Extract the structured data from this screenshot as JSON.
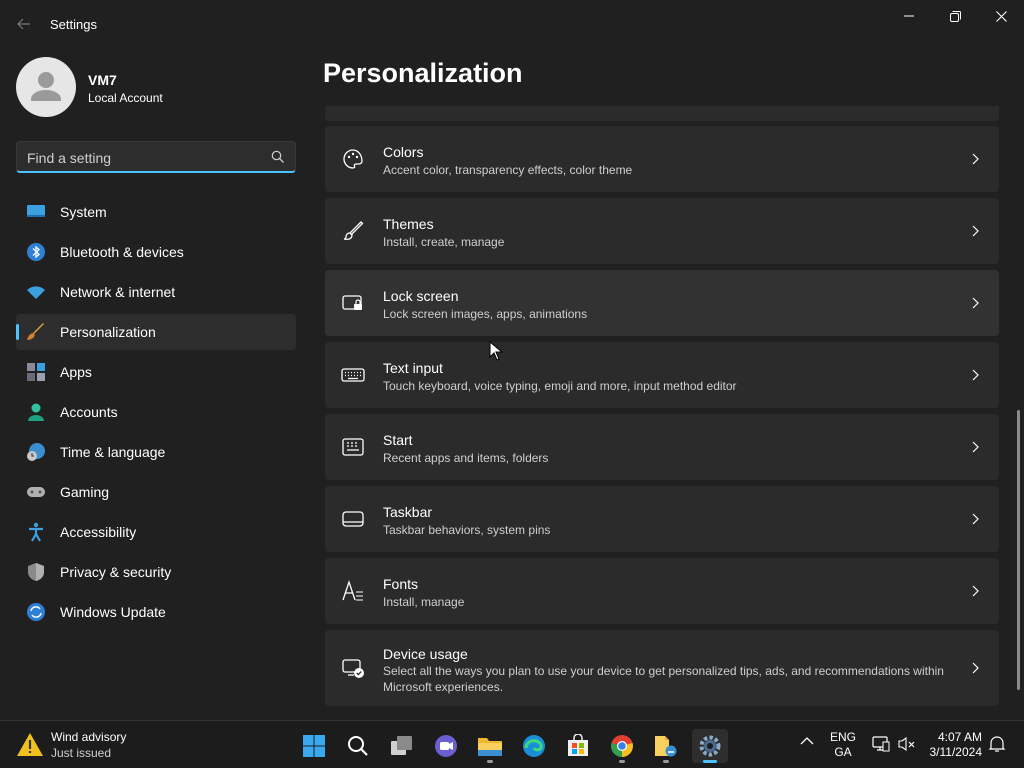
{
  "window": {
    "app_title": "Settings",
    "back_icon": "back-arrow-icon",
    "controls": [
      "minimize-icon",
      "maximize-icon",
      "close-icon"
    ]
  },
  "profile": {
    "name": "VM7",
    "account_type": "Local Account"
  },
  "search": {
    "placeholder": "Find a setting"
  },
  "sidebar": {
    "items": [
      {
        "label": "System",
        "icon": "monitor-icon",
        "selected": false
      },
      {
        "label": "Bluetooth & devices",
        "icon": "bluetooth-icon",
        "selected": false
      },
      {
        "label": "Network & internet",
        "icon": "wifi-icon",
        "selected": false
      },
      {
        "label": "Personalization",
        "icon": "paintbrush-icon",
        "selected": true
      },
      {
        "label": "Apps",
        "icon": "apps-icon",
        "selected": false
      },
      {
        "label": "Accounts",
        "icon": "person-icon",
        "selected": false
      },
      {
        "label": "Time & language",
        "icon": "clock-globe-icon",
        "selected": false
      },
      {
        "label": "Gaming",
        "icon": "gamepad-icon",
        "selected": false
      },
      {
        "label": "Accessibility",
        "icon": "accessibility-icon",
        "selected": false
      },
      {
        "label": "Privacy & security",
        "icon": "shield-icon",
        "selected": false
      },
      {
        "label": "Windows Update",
        "icon": "update-icon",
        "selected": false
      }
    ]
  },
  "main": {
    "title": "Personalization",
    "cards": [
      {
        "title": "Colors",
        "subtitle": "Accent color, transparency effects, color theme",
        "icon": "palette-icon"
      },
      {
        "title": "Themes",
        "subtitle": "Install, create, manage",
        "icon": "brush-icon"
      },
      {
        "title": "Lock screen",
        "subtitle": "Lock screen images, apps, animations",
        "icon": "lock-screen-icon"
      },
      {
        "title": "Text input",
        "subtitle": "Touch keyboard, voice typing, emoji and more, input method editor",
        "icon": "keyboard-icon"
      },
      {
        "title": "Start",
        "subtitle": "Recent apps and items, folders",
        "icon": "start-icon"
      },
      {
        "title": "Taskbar",
        "subtitle": "Taskbar behaviors, system pins",
        "icon": "taskbar-icon"
      },
      {
        "title": "Fonts",
        "subtitle": "Install, manage",
        "icon": "fonts-icon"
      },
      {
        "title": "Device usage",
        "subtitle": "Select all the ways you plan to use your device to get personalized tips, ads, and recommendations within Microsoft experiences.",
        "icon": "device-usage-icon"
      }
    ]
  },
  "taskbar": {
    "weather": {
      "title": "Wind advisory",
      "subtitle": "Just issued",
      "icon": "warning-weather-icon"
    },
    "apps": [
      "windows-start-icon",
      "search-icon",
      "task-view-icon",
      "teams-chat-icon",
      "file-explorer-icon",
      "edge-icon",
      "store-icon",
      "chrome-icon",
      "file-manager-icon",
      "settings-icon"
    ],
    "language": {
      "line1": "ENG",
      "line2": "GA"
    },
    "clock": {
      "time": "4:07 AM",
      "date": "3/11/2024"
    }
  },
  "colors": {
    "accent": "#4cc2ff",
    "background": "#202020",
    "card": "#2b2b2b"
  }
}
